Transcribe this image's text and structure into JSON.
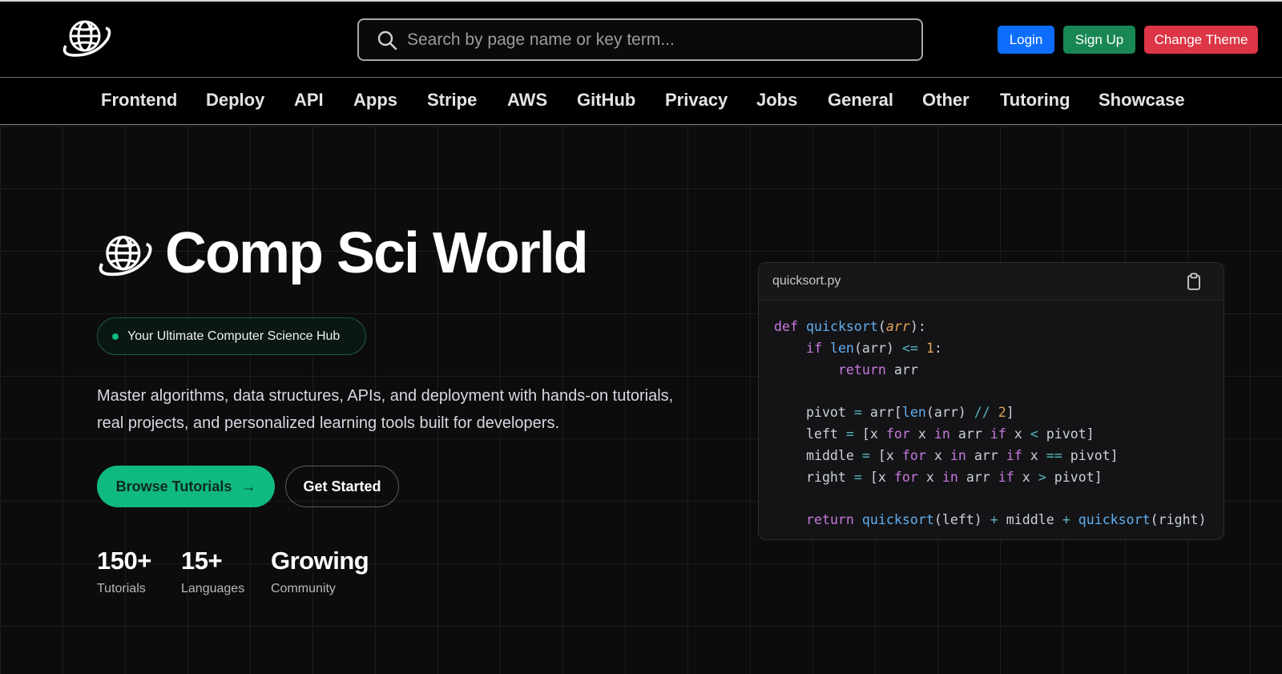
{
  "header": {
    "search_placeholder": "Search by page name or key term...",
    "buttons": {
      "login": "Login",
      "signup": "Sign Up",
      "theme": "Change Theme"
    },
    "colors": {
      "login": "#0d6efd",
      "signup": "#198754",
      "theme": "#dc3545"
    }
  },
  "nav": {
    "items": [
      "Frontend",
      "Deploy",
      "API",
      "Apps",
      "Stripe",
      "AWS",
      "GitHub",
      "Privacy",
      "Jobs",
      "General",
      "Other",
      "Tutoring",
      "Showcase"
    ]
  },
  "hero": {
    "title": "Comp Sci World",
    "badge": "Your Ultimate Computer Science Hub",
    "description": "Master algorithms, data structures, APIs, and deployment with hands-on tutorials, real projects, and personalized learning tools built for developers.",
    "primary_button": "Browse Tutorials",
    "secondary_button": "Get Started",
    "accent_color": "#10b981",
    "stats": [
      {
        "value": "150+",
        "label": "Tutorials"
      },
      {
        "value": "15+",
        "label": "Languages"
      },
      {
        "value": "Growing",
        "label": "Community"
      }
    ]
  },
  "code_card": {
    "filename": "quicksort.py",
    "copy_icon": "clipboard-icon",
    "code": [
      "def quicksort(arr):",
      "    if len(arr) <= 1:",
      "        return arr",
      "",
      "    pivot = arr[len(arr) // 2]",
      "    left = [x for x in arr if x < pivot]",
      "    middle = [x for x in arr if x == pivot]",
      "    right = [x for x in arr if x > pivot]",
      "",
      "    return quicksort(left) + middle + quicksort(right)"
    ]
  }
}
